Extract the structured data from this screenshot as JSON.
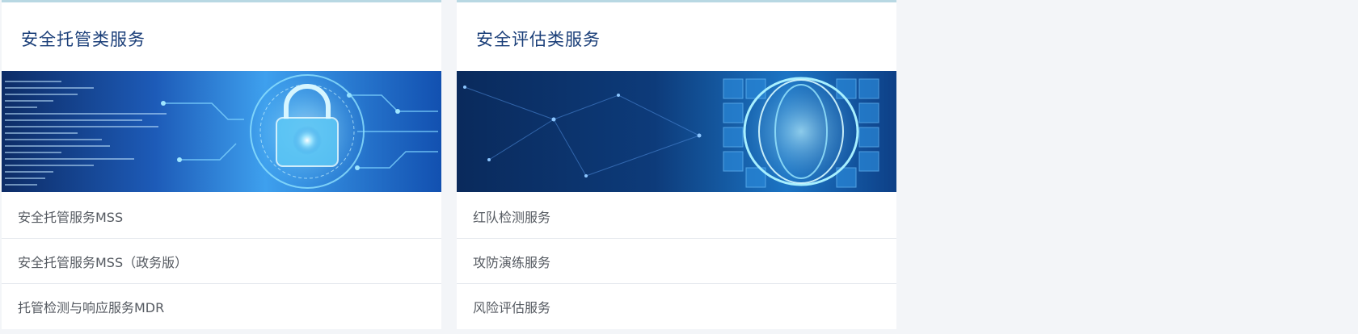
{
  "cards": [
    {
      "title": "安全托管类服务",
      "banner_icon": "padlock-circuit-image",
      "items": [
        {
          "label": "安全托管服务MSS"
        },
        {
          "label": "安全托管服务MSS（政务版）"
        },
        {
          "label": "托管检测与响应服务MDR"
        }
      ]
    },
    {
      "title": "安全评估类服务",
      "banner_icon": "cube-rings-image",
      "items": [
        {
          "label": "红队检测服务"
        },
        {
          "label": "攻防演练服务"
        },
        {
          "label": "风险评估服务"
        }
      ]
    }
  ],
  "colors": {
    "title": "#1b3f79",
    "item_text": "#555a61",
    "card_accent": "#b8d8e3",
    "page_bg": "#f3f5f8"
  }
}
